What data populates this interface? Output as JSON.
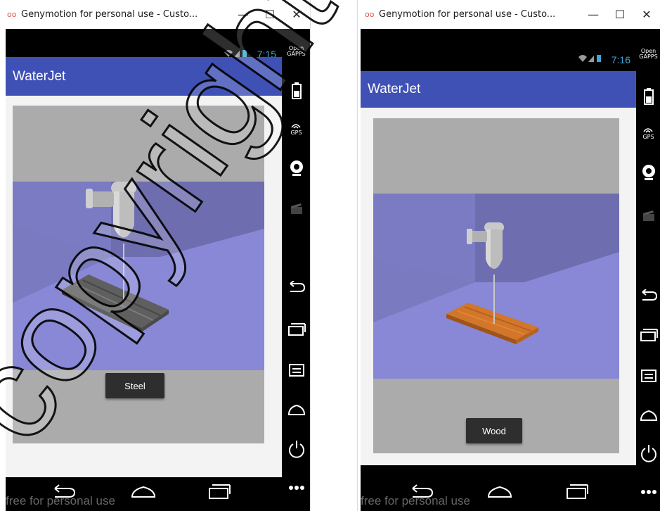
{
  "windows": [
    {
      "title": "Genymotion for personal use - Custo...",
      "status_time": "7:15",
      "app_title": "WaterJet",
      "material_button": "Steel",
      "watermark": "free for personal use",
      "sidebar": {
        "gapps_line1": "Open",
        "gapps_line2": "GAPPS",
        "gps": "GPS"
      }
    },
    {
      "title": "Genymotion for personal use - Custo...",
      "status_time": "7:16",
      "app_title": "WaterJet",
      "material_button": "Wood",
      "watermark": "free for personal use",
      "sidebar": {
        "gapps_line1": "Open",
        "gapps_line2": "GAPPS",
        "gps": "GPS"
      }
    }
  ],
  "controls": {
    "minimize": "—",
    "maximize": "☐",
    "close": "✕"
  },
  "icons": [
    "battery-icon",
    "gps-icon",
    "webcam-icon",
    "video-clapper-icon",
    "back-icon",
    "recents-icon",
    "menu-icon",
    "home-icon",
    "power-icon",
    "more-icon"
  ],
  "colors": {
    "appbar": "#3f51b5",
    "room_wall": "#7f7fc9",
    "floor": "#8d8dd6",
    "steel": "#6a6a6a",
    "wood": "#d2762a"
  },
  "overlay_watermark": "copyright"
}
